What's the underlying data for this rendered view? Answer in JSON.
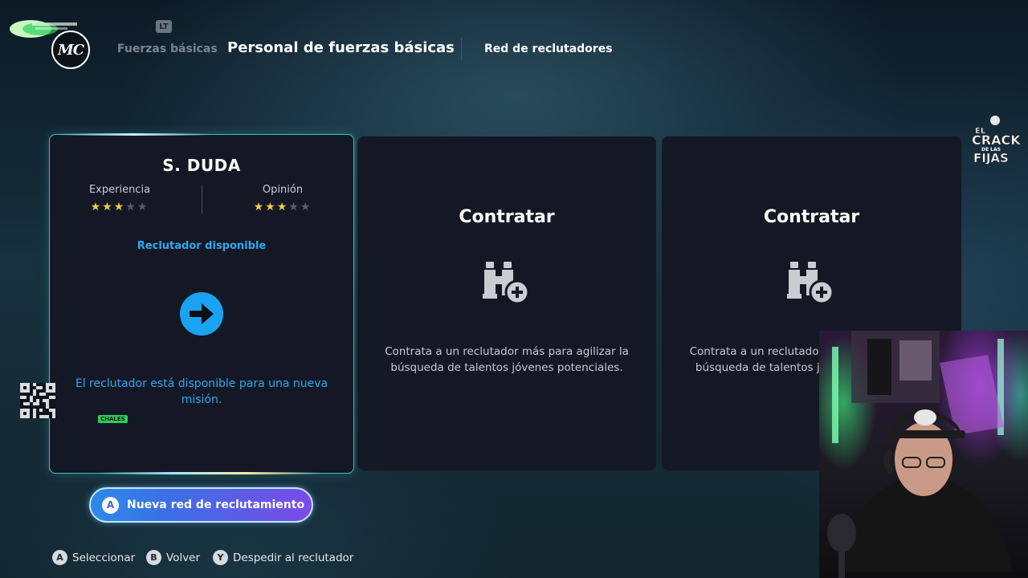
{
  "nav": {
    "lt_hint": "LT",
    "logo_text": "MC",
    "tab_basic": "Fuerzas básicas",
    "tab_staff": "Personal de fuerzas básicas",
    "tab_network": "Red de reclutadores"
  },
  "recruiter_card": {
    "name": "S. DUDA",
    "experience_label": "Experiencia",
    "experience_stars": 3,
    "opinion_label": "Opinión",
    "opinion_stars": 3,
    "max_stars": 5,
    "status": "Reclutador disponible",
    "description": "El reclutador está disponible para una nueva misión.",
    "overlay_tag": "CHALES"
  },
  "hire_cards": [
    {
      "title": "Contratar",
      "description": "Contrata a un reclutador más para agilizar la búsqueda de talentos jóvenes potenciales."
    },
    {
      "title": "Contratar",
      "description": "Contrata a un reclutador más para agilizar la búsqueda de talentos jóvenes potenciales."
    }
  ],
  "primary_action": {
    "button_glyph": "A",
    "label": "Nueva red de reclutamiento"
  },
  "hints": [
    {
      "glyph": "A",
      "label": "Seleccionar"
    },
    {
      "glyph": "B",
      "label": "Volver"
    },
    {
      "glyph": "Y",
      "label": "Despedir al reclutador"
    }
  ],
  "colors": {
    "accent_blue": "#2ea8f2",
    "star_on": "#f2c94c",
    "card_border": "#36c6c8"
  },
  "icons": {
    "arrow": "arrow-right-circle-icon",
    "binoculars": "binoculars-add-icon"
  }
}
